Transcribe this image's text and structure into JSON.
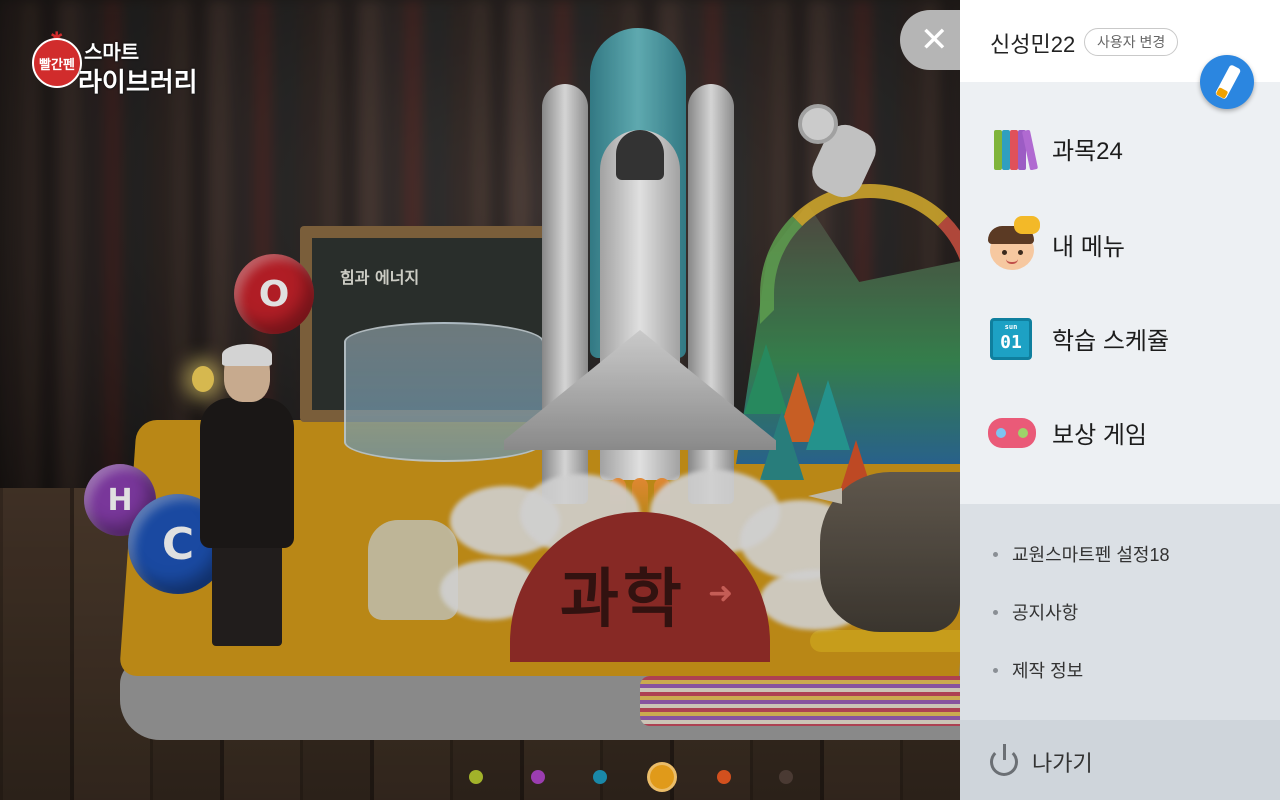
{
  "app": {
    "logo_badge": "빨간펜",
    "logo_top": "스마트",
    "logo_main": "라이브러리"
  },
  "scene": {
    "board_text": "힘과 에너지",
    "subject_label": "과학",
    "atoms": [
      "O",
      "H",
      "C"
    ],
    "page_dots": [
      "#a2b22a",
      "#9b3db0",
      "#1a88a8",
      "#e09a1a",
      "#d2501e",
      "#4a3a33"
    ],
    "active_page": 3
  },
  "panel": {
    "user_name": "신성민22",
    "switch_user_label": "사용자 변경",
    "menu": [
      {
        "label": "과목24",
        "icon": "books-icon"
      },
      {
        "label": "내 메뉴",
        "icon": "face-icon"
      },
      {
        "label": "학습 스케쥴",
        "icon": "calendar-icon",
        "icon_text": "01",
        "icon_small": "sun"
      },
      {
        "label": "보상 게임",
        "icon": "gamepad-icon"
      }
    ],
    "sub_menu": [
      {
        "label": "교원스마트펜 설정18"
      },
      {
        "label": "공지사항"
      },
      {
        "label": "제작 정보"
      }
    ],
    "exit_label": "나가기"
  },
  "colors": {
    "panel_bg": "#edf0f3",
    "sub_bg": "#dbe0e5",
    "exit_bg": "#cfd5db",
    "pen_button": "#2b86e0"
  }
}
